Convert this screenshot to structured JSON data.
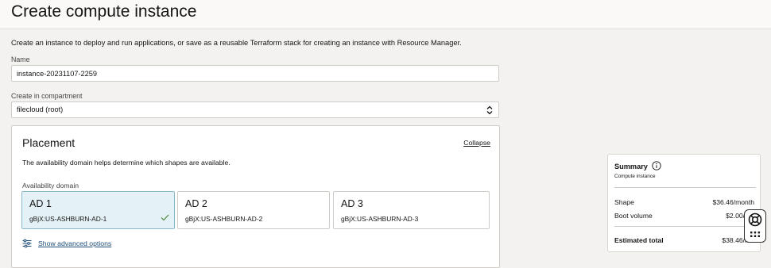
{
  "page": {
    "title": "Create compute instance",
    "intro": "Create an instance to deploy and run applications, or save as a reusable Terraform stack for creating an instance with Resource Manager."
  },
  "name_field": {
    "label": "Name",
    "value": "instance-20231107-2259"
  },
  "compartment_field": {
    "label": "Create in compartment",
    "value": "filecloud (root)",
    "icon": "chevron-updown-icon"
  },
  "placement": {
    "title": "Placement",
    "collapse_label": "Collapse",
    "description": "The availability domain helps determine which shapes are available.",
    "ad_label": "Availability domain",
    "domains": [
      {
        "name": "AD 1",
        "id": "gBjX:US-ASHBURN-AD-1",
        "selected": true
      },
      {
        "name": "AD 2",
        "id": "gBjX:US-ASHBURN-AD-2",
        "selected": false
      },
      {
        "name": "AD 3",
        "id": "gBjX:US-ASHBURN-AD-3",
        "selected": false
      }
    ],
    "advanced_label": "Show advanced options"
  },
  "summary": {
    "title": "Summary",
    "subtitle": "Compute instance",
    "rows": [
      {
        "label": "Shape",
        "value": "$36.46/month"
      },
      {
        "label": "Boot volume",
        "value": "$2.00/mo"
      }
    ],
    "total_label": "Estimated total",
    "total_value": "$38.46/mo"
  },
  "colors": {
    "selected_card_bg": "#e4f1f7",
    "link_blue": "#1f4e79",
    "check_green": "#4a8a3a"
  }
}
